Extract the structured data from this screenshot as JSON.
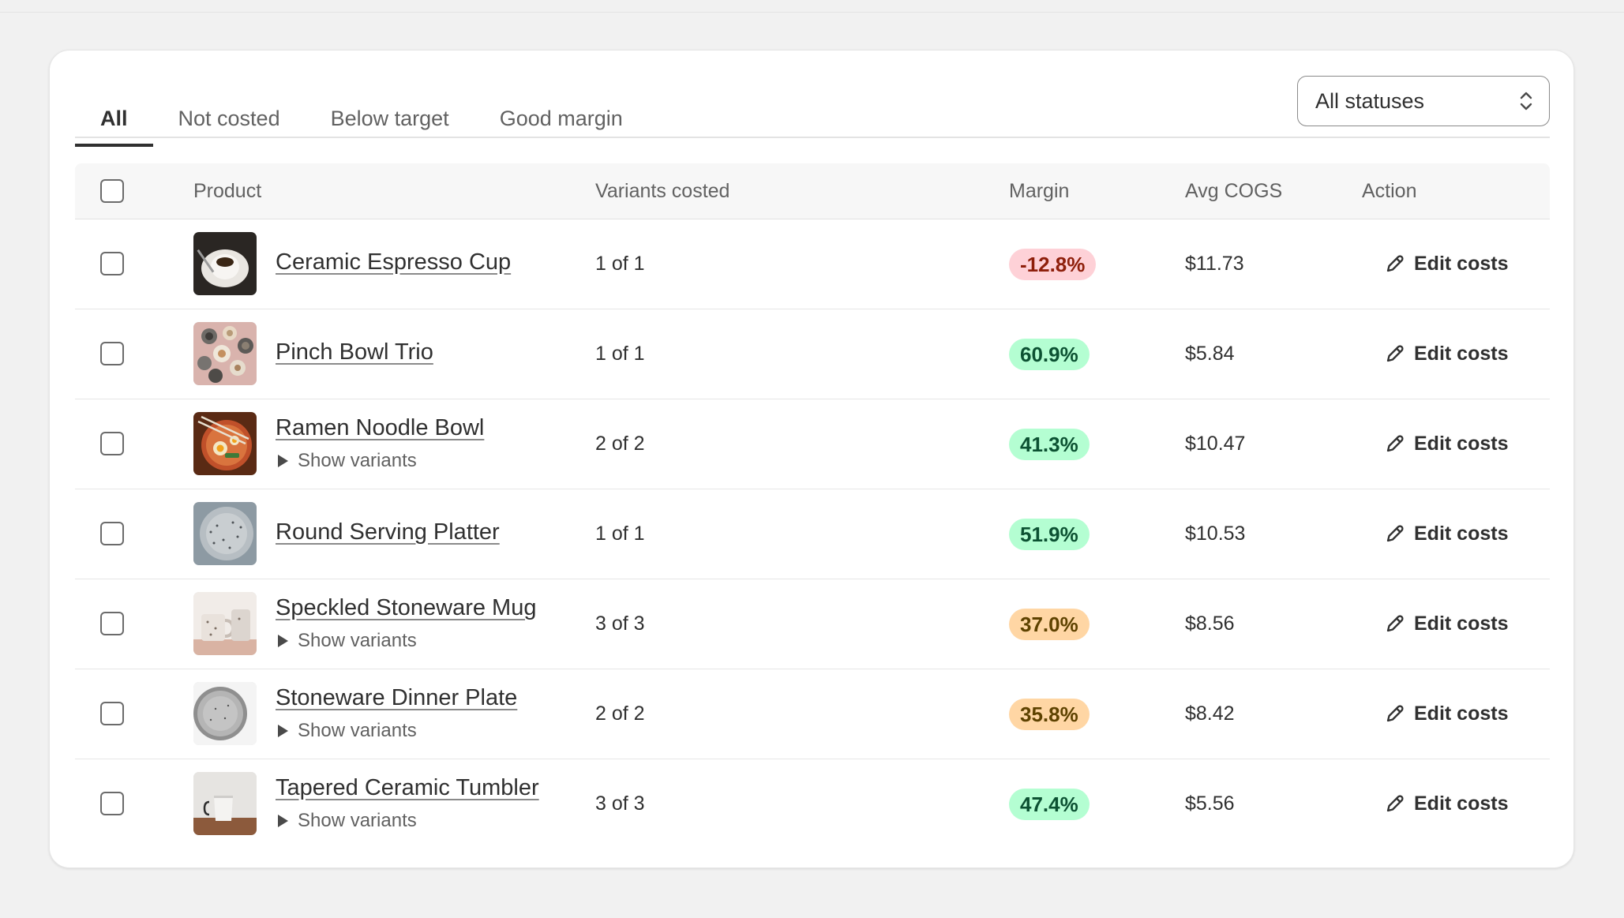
{
  "tabs": [
    {
      "label": "All",
      "active": true
    },
    {
      "label": "Not costed",
      "active": false
    },
    {
      "label": "Below target",
      "active": false
    },
    {
      "label": "Good margin",
      "active": false
    }
  ],
  "status_filter": {
    "selected": "All statuses"
  },
  "table": {
    "headers": {
      "product": "Product",
      "variants": "Variants costed",
      "margin": "Margin",
      "cogs": "Avg COGS",
      "action": "Action"
    },
    "action_label": "Edit costs",
    "show_variants_label": "Show variants",
    "rows": [
      {
        "name": "Ceramic Espresso Cup",
        "variants": "1 of 1",
        "margin": "-12.8%",
        "margin_status": "negative",
        "cogs": "$11.73",
        "has_variants": false,
        "thumb": "espresso-cup"
      },
      {
        "name": "Pinch Bowl Trio",
        "variants": "1 of 1",
        "margin": "60.9%",
        "margin_status": "good",
        "cogs": "$5.84",
        "has_variants": false,
        "thumb": "pinch-bowls"
      },
      {
        "name": "Ramen Noodle Bowl",
        "variants": "2 of 2",
        "margin": "41.3%",
        "margin_status": "good",
        "cogs": "$10.47",
        "has_variants": true,
        "thumb": "ramen-bowl"
      },
      {
        "name": "Round Serving Platter",
        "variants": "1 of 1",
        "margin": "51.9%",
        "margin_status": "good",
        "cogs": "$10.53",
        "has_variants": false,
        "thumb": "serving-platter"
      },
      {
        "name": "Speckled Stoneware Mug",
        "variants": "3 of 3",
        "margin": "37.0%",
        "margin_status": "below",
        "cogs": "$8.56",
        "has_variants": true,
        "thumb": "stoneware-mug"
      },
      {
        "name": "Stoneware Dinner Plate",
        "variants": "2 of 2",
        "margin": "35.8%",
        "margin_status": "below",
        "cogs": "$8.42",
        "has_variants": true,
        "thumb": "dinner-plate"
      },
      {
        "name": "Tapered Ceramic Tumbler",
        "variants": "3 of 3",
        "margin": "47.4%",
        "margin_status": "good",
        "cogs": "$5.56",
        "has_variants": true,
        "thumb": "ceramic-tumbler"
      }
    ]
  },
  "colors": {
    "negative_bg": "#fed1d7",
    "good_bg": "#b4fed2",
    "below_bg": "#ffd6a4",
    "page_bg": "#f1f1f1"
  },
  "icons": {
    "edit": "pencil-icon",
    "select": "chevron-up-down-icon",
    "expand": "triangle-right-icon"
  }
}
